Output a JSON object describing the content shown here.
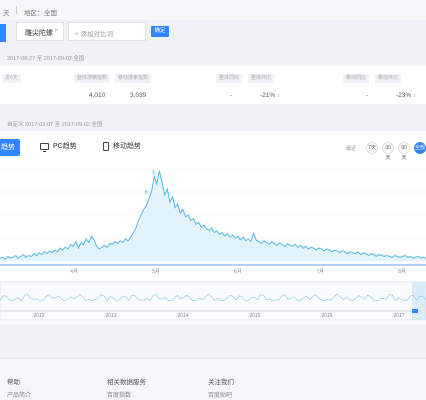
{
  "breadcrumb": {
    "prefix": "天",
    "region_label": "地区：",
    "region_value": "全国"
  },
  "keyword": {
    "text": "雕尖陀螺",
    "close": "×",
    "add_placeholder": "+ 添加对比词",
    "confirm_label": "确定"
  },
  "stat_range": "2017-08-27 至 2017-09-02  全国",
  "stats": {
    "left_tag": "近6天",
    "headers": [
      "整体搜索指数",
      "移动搜索指数",
      "整体同比",
      "整体环比",
      "移动同比",
      "移动环比"
    ],
    "values": [
      "4,010",
      "3,039",
      "-",
      "-21%",
      "-",
      "-23%"
    ],
    "down_arrow": "↓"
  },
  "trend_range": "自定义   2017-03-07 至 2017-09-02   全国",
  "tabs": {
    "active": "趋势",
    "pc": "PC趋势",
    "mobile": "移动趋势"
  },
  "range_label": "最近",
  "range_buttons": [
    "7天",
    "30天",
    "90天",
    "全部"
  ],
  "chart_data": {
    "type": "area",
    "x_labels": [
      "4月",
      "5月",
      "6月",
      "7月",
      "8月"
    ],
    "values": [
      0.03,
      0.04,
      0.02,
      0.05,
      0.03,
      0.04,
      0.06,
      0.03,
      0.05,
      0.07,
      0.04,
      0.06,
      0.05,
      0.08,
      0.06,
      0.09,
      0.07,
      0.1,
      0.08,
      0.11,
      0.09,
      0.12,
      0.1,
      0.14,
      0.12,
      0.15,
      0.13,
      0.18,
      0.16,
      0.21,
      0.14,
      0.2,
      0.18,
      0.24,
      0.2,
      0.27,
      0.23,
      0.16,
      0.13,
      0.15,
      0.17,
      0.15,
      0.19,
      0.18,
      0.21,
      0.19,
      0.22,
      0.2,
      0.24,
      0.22,
      0.26,
      0.3,
      0.36,
      0.44,
      0.5,
      0.56,
      0.6,
      0.68,
      0.76,
      0.92,
      0.84,
      0.98,
      0.86,
      0.72,
      0.78,
      0.64,
      0.7,
      0.58,
      0.62,
      0.52,
      0.56,
      0.48,
      0.5,
      0.44,
      0.46,
      0.4,
      0.42,
      0.37,
      0.39,
      0.35,
      0.33,
      0.36,
      0.31,
      0.33,
      0.29,
      0.31,
      0.27,
      0.3,
      0.26,
      0.28,
      0.25,
      0.27,
      0.23,
      0.26,
      0.22,
      0.24,
      0.21,
      0.3,
      0.23,
      0.21,
      0.19,
      0.22,
      0.2,
      0.18,
      0.21,
      0.19,
      0.17,
      0.2,
      0.18,
      0.16,
      0.19,
      0.17,
      0.16,
      0.18,
      0.15,
      0.17,
      0.14,
      0.16,
      0.13,
      0.15,
      0.14,
      0.12,
      0.14,
      0.13,
      0.11,
      0.13,
      0.12,
      0.1,
      0.12,
      0.11,
      0.09,
      0.11,
      0.1,
      0.08,
      0.1,
      0.09,
      0.08,
      0.1,
      0.07,
      0.09,
      0.08,
      0.06,
      0.08,
      0.07,
      0.05,
      0.07,
      0.06,
      0.05,
      0.06,
      0.05,
      0.04,
      0.06,
      0.05,
      0.04,
      0.05,
      0.06,
      0.04,
      0.05,
      0.03,
      0.04,
      0.05,
      0.03,
      0.04,
      0.03
    ],
    "annotations": [
      "E",
      "B"
    ],
    "overview_years": [
      "2012",
      "2013",
      "2014",
      "2015",
      "2016",
      "2017"
    ]
  },
  "footer": {
    "help": {
      "title": "帮助",
      "item": "产品简介"
    },
    "services": {
      "title": "相关数据服务",
      "item": "百度指数"
    },
    "follow": {
      "title": "关注我们",
      "item": "百度贴吧"
    }
  },
  "colors": {
    "accent": "#3385ff",
    "down": "#35b36b",
    "line": "#55b8e0"
  }
}
